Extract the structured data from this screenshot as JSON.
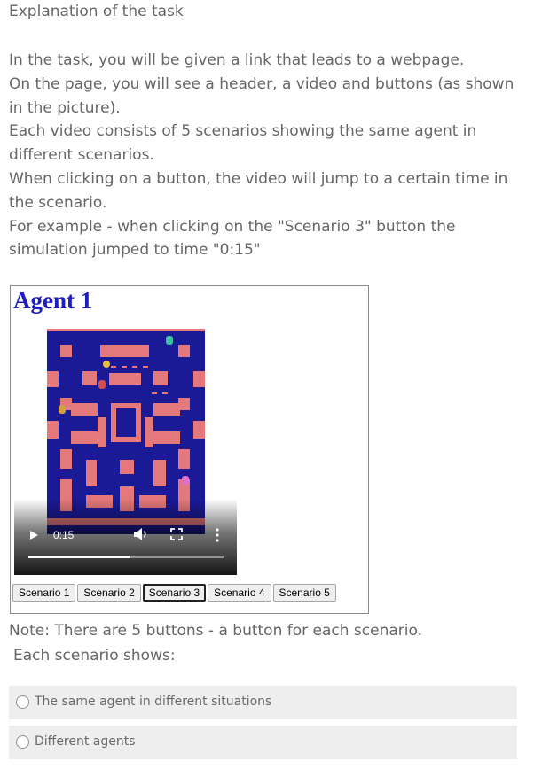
{
  "page": {
    "title": "Explanation of the task",
    "paragraphs": [
      "In the task, you will be given a link that leads to a webpage.",
      "On the page, you will see a header, a video and buttons (as shown in the picture).",
      "Each video consists of 5 scenarios showing the same agent in different scenarios.",
      "When clicking on a button, the video will jump to a certain time in the scenario.",
      "For example - when clicking on the \"Scenario 3\" button the simulation jumped to time \"0:15\""
    ]
  },
  "figure": {
    "agent_title": "Agent 1",
    "video": {
      "time": "0:15",
      "progress": 0.52,
      "icons": [
        "play-icon",
        "volume-icon",
        "fullscreen-icon",
        "more-options-icon"
      ]
    },
    "buttons": [
      {
        "label": "Scenario 1",
        "active": false
      },
      {
        "label": "Scenario 2",
        "active": false
      },
      {
        "label": "Scenario 3",
        "active": true
      },
      {
        "label": "Scenario 4",
        "active": false
      },
      {
        "label": "Scenario 5",
        "active": false
      }
    ]
  },
  "note": "Note: There are 5 buttons - a button for each scenario.",
  "question": {
    "prompt": "Each scenario shows:",
    "options": [
      "The same agent in different situations",
      "Different agents"
    ],
    "selected": null
  },
  "colors": {
    "maze_background": "#1a1a96",
    "maze_walls": "#e5787a",
    "agent_title": "#1e1ec0",
    "option_background": "#eeeeee"
  }
}
